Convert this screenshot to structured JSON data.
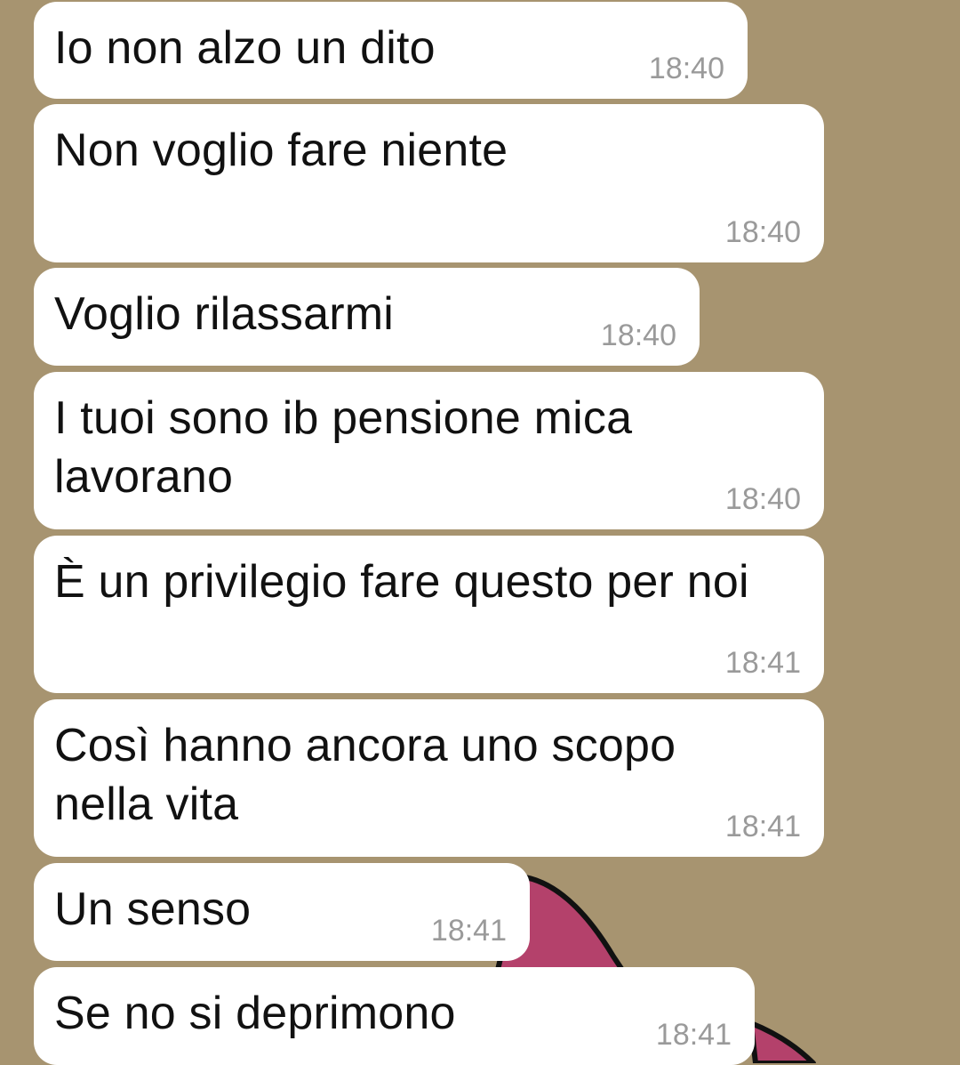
{
  "chat": {
    "messages": [
      {
        "text": "Io non alzo un dito",
        "time": "18:40"
      },
      {
        "text": "Non voglio fare niente",
        "time": "18:40"
      },
      {
        "text": "Voglio rilassarmi",
        "time": "18:40"
      },
      {
        "text": "I tuoi sono ib pensione mica\nlavorano",
        "time": "18:40"
      },
      {
        "text": "È un privilegio fare questo per noi",
        "time": "18:41"
      },
      {
        "text": "Così hanno ancora uno scopo\nnella vita",
        "time": "18:41"
      },
      {
        "text": "Un senso",
        "time": "18:41"
      },
      {
        "text": "Se no si deprimono",
        "time": "18:41"
      }
    ]
  },
  "colors": {
    "wallpaper": "#a79470",
    "bubble": "#ffffff",
    "text": "#111111",
    "timestamp": "#9a9a9a",
    "sticker_fill": "#b4416b"
  },
  "icons": {
    "sticker": "partial-pink-sticker"
  }
}
